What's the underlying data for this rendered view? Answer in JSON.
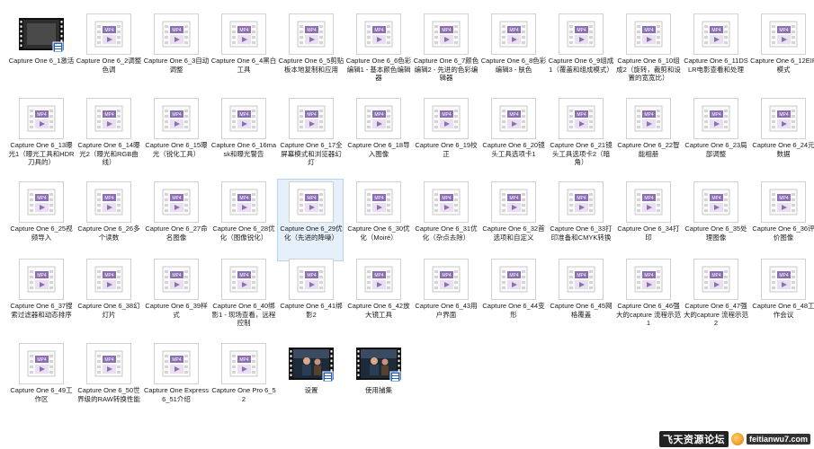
{
  "icons": {
    "doc_icon": "mp4-file-icon",
    "video_icon": "video-thumbnail-icon",
    "badge_text": "MP4"
  },
  "colors": {
    "badge": "#8c6fb3",
    "selected_bg": "#e6f0fb"
  },
  "files": [
    {
      "label": "Capture One 6_1激活",
      "type": "video"
    },
    {
      "label": "Capture One 6_2调整色调",
      "type": "doc"
    },
    {
      "label": "Capture One 6_3自动调整",
      "type": "doc"
    },
    {
      "label": "Capture One 6_4黑白工具",
      "type": "doc"
    },
    {
      "label": "Capture One 6_5剪贴板本地复制和应用",
      "type": "doc"
    },
    {
      "label": "Capture One 6_6色彩编辑1 - 基本颜色编辑器",
      "type": "doc"
    },
    {
      "label": "Capture One 6_7颜色编辑2 - 先进的色彩编辑器",
      "type": "doc"
    },
    {
      "label": "Capture One 6_8色彩编辑3 - 肤色",
      "type": "doc"
    },
    {
      "label": "Capture One 6_9组成1（覆盖和组成模式）",
      "type": "doc"
    },
    {
      "label": "Capture One 6_10组成2（旋转，裁剪和设置的宽宽比）",
      "type": "doc"
    },
    {
      "label": "Capture One 6_11DSLR电影查看和处理",
      "type": "doc"
    },
    {
      "label": "Capture One 6_12EIP模式",
      "type": "doc"
    },
    {
      "label": "Capture One 6_13曝光1（曝光工具和HDR刀具的）",
      "type": "doc"
    },
    {
      "label": "Capture One 6_14曝光2（曝光和RGB曲线）",
      "type": "doc"
    },
    {
      "label": "Capture One 6_15曝光（锐化工具）",
      "type": "doc"
    },
    {
      "label": "Capture One 6_16mask和曝光警告",
      "type": "doc"
    },
    {
      "label": "Capture One 6_17全屏幕模式和浏览器幻灯",
      "type": "doc"
    },
    {
      "label": "Capture One 6_18导入图像",
      "type": "doc"
    },
    {
      "label": "Capture One 6_19校正",
      "type": "doc"
    },
    {
      "label": "Capture One 6_20镜头工具选项卡1",
      "type": "doc"
    },
    {
      "label": "Capture One 6_21镜头工具选项卡2（暗角）",
      "type": "doc"
    },
    {
      "label": "Capture One 6_22智能相册",
      "type": "doc"
    },
    {
      "label": "Capture One 6_23局部调整",
      "type": "doc"
    },
    {
      "label": "Capture One 6_24元数据",
      "type": "doc"
    },
    {
      "label": "Capture One 6_25视频导入",
      "type": "doc"
    },
    {
      "label": "Capture One 6_26多个读数",
      "type": "doc"
    },
    {
      "label": "Capture One 6_27命名图像",
      "type": "doc"
    },
    {
      "label": "Capture One 6_28优化（图像锐化）",
      "type": "doc"
    },
    {
      "label": "Capture One 6_29优化（先进的降噪）",
      "type": "doc",
      "selected": true
    },
    {
      "label": "Capture One 6_30优化（Moiré）",
      "type": "doc"
    },
    {
      "label": "Capture One 6_31优化（杂点去除）",
      "type": "doc"
    },
    {
      "label": "Capture One 6_32首选项和自定义",
      "type": "doc"
    },
    {
      "label": "Capture One 6_33打印准备和CMYK转换",
      "type": "doc"
    },
    {
      "label": "Capture One 6_34打印",
      "type": "doc"
    },
    {
      "label": "Capture One 6_35处理图像",
      "type": "doc"
    },
    {
      "label": "Capture One 6_36评价图像",
      "type": "doc"
    },
    {
      "label": "Capture One 6_37搜索过滤器和动态排序",
      "type": "doc"
    },
    {
      "label": "Capture One 6_38幻灯片",
      "type": "doc"
    },
    {
      "label": "Capture One 6_39样式",
      "type": "doc"
    },
    {
      "label": "Capture One 6_40绑影1 - 现场查看，远程控制",
      "type": "doc"
    },
    {
      "label": "Capture One 6_41绑影2",
      "type": "doc"
    },
    {
      "label": "Capture One 6_42放大镜工具",
      "type": "doc"
    },
    {
      "label": "Capture One 6_43用户界面",
      "type": "doc"
    },
    {
      "label": "Capture One 6_44变形",
      "type": "doc"
    },
    {
      "label": "Capture One 6_45网格覆盖",
      "type": "doc"
    },
    {
      "label": "Capture One 6_46强大的capture 流程示范1",
      "type": "doc"
    },
    {
      "label": "Capture One 6_47强大的capture 流程示范2",
      "type": "doc"
    },
    {
      "label": "Capture One 6_48工作会议",
      "type": "doc"
    },
    {
      "label": "Capture One 6_49工作区",
      "type": "doc"
    },
    {
      "label": "Capture One 6_50世界级的RAW转换性能",
      "type": "doc"
    },
    {
      "label": "Capture One Express 6_51介绍",
      "type": "doc"
    },
    {
      "label": "Capture One Pro 6_52",
      "type": "doc"
    },
    {
      "label": "设置",
      "type": "person"
    },
    {
      "label": "使用捕集",
      "type": "person"
    }
  ],
  "watermark": {
    "text": "飞天资源论坛",
    "site": "feitianwu7.com"
  }
}
